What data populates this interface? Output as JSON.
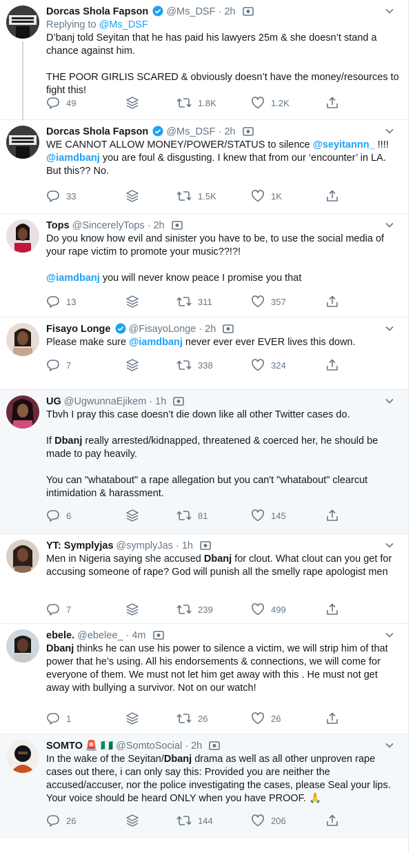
{
  "tweets": [
    {
      "name": "Dorcas Shola Fapson",
      "verified": true,
      "handle": "@Ms_DSF",
      "time": "· 2h",
      "replying_label": "Replying to",
      "replying_handle": "@Ms_DSF",
      "paragraphs": [
        [
          {
            "t": "D’banj told Seyitan that he has paid his lawyers 25m & she doesn’t stand a chance against him."
          }
        ],
        [
          {
            "t": "THE POOR GIRLIS SCARED & obviously doesn’t have the money/resources to fight this!"
          }
        ]
      ],
      "replies": "49",
      "retweets": "1.8K",
      "likes": "1.2K"
    },
    {
      "name": "Dorcas Shola Fapson",
      "verified": true,
      "handle": "@Ms_DSF",
      "time": "· 2h",
      "paragraphs": [
        [
          {
            "t": "WE CANNOT ALLOW MONEY/POWER/STATUS to silence "
          },
          {
            "t": "@seyitannn_",
            "s": "mention"
          },
          {
            "t": " !!!! "
          },
          {
            "t": "@iamdbanj",
            "s": "mention"
          },
          {
            "t": " you are foul & disgusting. I knew that from our ‘encounter’ in LA. But this?? No."
          }
        ]
      ],
      "replies": "33",
      "retweets": "1.5K",
      "likes": "1K"
    },
    {
      "name": "Tops",
      "verified": false,
      "handle": "@SincerelyTops",
      "time": "· 2h",
      "paragraphs": [
        [
          {
            "t": "Do you know how evil and sinister you have to be, to use the social media of your rape victim to promote your music??!?!"
          }
        ],
        [
          {
            "t": "@iamdbanj",
            "s": "mention"
          },
          {
            "t": " you will never know peace I promise you that"
          }
        ]
      ],
      "replies": "13",
      "retweets": "311",
      "likes": "357"
    },
    {
      "name": "Fisayo Longe",
      "verified": true,
      "handle": "@FisayoLonge",
      "time": "· 2h",
      "paragraphs": [
        [
          {
            "t": "Please make sure "
          },
          {
            "t": "@iamdbanj",
            "s": "mention"
          },
          {
            "t": " never ever ever EVER lives this down."
          }
        ]
      ],
      "replies": "7",
      "retweets": "338",
      "likes": "324"
    },
    {
      "name": "UG",
      "verified": false,
      "handle": "@UgwunnaEjikem",
      "time": "· 1h",
      "highlight": true,
      "paragraphs": [
        [
          {
            "t": "Tbvh I pray this case doesn’t die down like all other Twitter cases do."
          }
        ],
        [
          {
            "t": "If "
          },
          {
            "t": "Dbanj",
            "s": "kw"
          },
          {
            "t": " really arrested/kidnapped, threatened & coerced her, he should be made to pay heavily."
          }
        ],
        [
          {
            "t": "You can \"whatabout\" a rape allegation but you can't \"whatabout\" clearcut intimidation & harassment."
          }
        ]
      ],
      "replies": "6",
      "retweets": "81",
      "likes": "145"
    },
    {
      "name": "YT: Symplyjas",
      "verified": false,
      "handle": "@symplyJas",
      "time": "· 1h",
      "paragraphs": [
        [
          {
            "t": "Men in Nigeria saying she accused "
          },
          {
            "t": "Dbanj",
            "s": "kw"
          },
          {
            "t": " for clout. What clout can you get for accusing someone of rape? God will punish all the smelly rape apologist men"
          }
        ]
      ],
      "replies": "7",
      "retweets": "239",
      "likes": "499"
    },
    {
      "name": "ebele.",
      "verified": false,
      "handle": "@ebelee_",
      "time": "· 4m",
      "paragraphs": [
        [
          {
            "t": "Dbanj",
            "s": "kw"
          },
          {
            "t": " thinks he can use his power to silence a victim, we will strip him of that power that he’s using. All his endorsements & connections, we will come for everyone of them. We must not let him get away with this . He must not get away with bullying a survivor. Not on our watch!"
          }
        ]
      ],
      "replies": "1",
      "retweets": "26",
      "likes": "26"
    },
    {
      "name": "SOMTO 🚨 🇳🇬",
      "verified": false,
      "handle": "@SomtoSocial",
      "time": "· 2h",
      "highlight": true,
      "paragraphs": [
        [
          {
            "t": "In the wake of the Seyitan/"
          },
          {
            "t": "Dbanj",
            "s": "kw"
          },
          {
            "t": " drama as well as all other unproven rape cases out there, i can only say this: Provided you are neither the accused/accuser, nor the police investigating the cases, please Seal your lips. Your voice should be heard ONLY when you have PROOF. 🙏"
          }
        ]
      ],
      "replies": "26",
      "retweets": "144",
      "likes": "206"
    }
  ],
  "colors": {
    "accent": "#1da1f2",
    "muted": "#657786",
    "text": "#14171a",
    "highlight_bg": "#f5f8fa"
  },
  "icons": [
    "reply-icon",
    "stack-icon",
    "retweet-icon",
    "like-icon",
    "share-icon",
    "verified-icon",
    "camera-icon",
    "chevron-down-icon"
  ]
}
